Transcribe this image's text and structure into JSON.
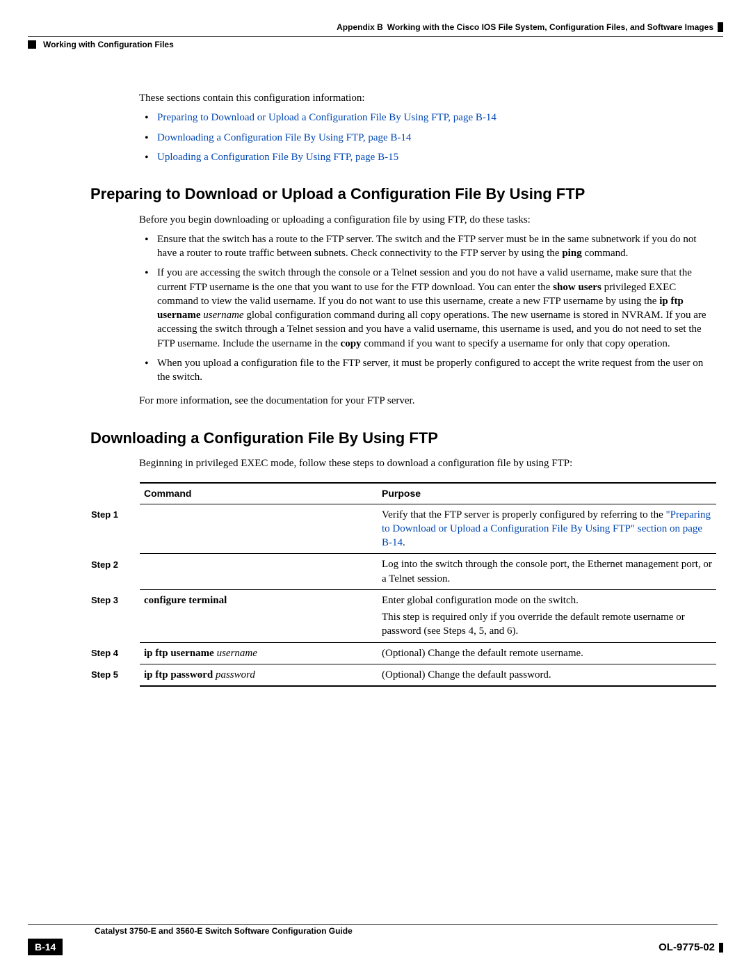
{
  "header": {
    "appendix": "Appendix B",
    "title": "Working with the Cisco IOS File System, Configuration Files, and Software Images",
    "section": "Working with Configuration Files"
  },
  "intro": "These sections contain this configuration information:",
  "toc": [
    "Preparing to Download or Upload a Configuration File By Using FTP, page B-14",
    "Downloading a Configuration File By Using FTP, page B-14",
    "Uploading a Configuration File By Using FTP, page B-15"
  ],
  "s1": {
    "heading": "Preparing to Download or Upload a Configuration File By Using FTP",
    "lead": "Before you begin downloading or uploading a configuration file by using FTP, do these tasks:",
    "b1": {
      "t1": "Ensure that the switch has a route to the FTP server. The switch and the FTP server must be in the same subnetwork if you do not have a router to route traffic between subnets. Check connectivity to the FTP server by using the ",
      "ping": "ping",
      "t2": " command."
    },
    "b2": {
      "t1": "If you are accessing the switch through the console or a Telnet session and you do not have a valid username, make sure that the current FTP username is the one that you want to use for the FTP download. You can enter the ",
      "showusers": "show users",
      "t2": " privileged EXEC command to view the valid username. If you do not want to use this username, create a new FTP username by using the ",
      "ipftpuser": "ip ftp username",
      "t3": " ",
      "usernameItalic": "username",
      "t4": " global configuration command during all copy operations. The new username is stored in NVRAM. If you are accessing the switch through a Telnet session and you have a valid username, this username is used, and you do not need to set the FTP username. Include the username in the ",
      "copy": "copy",
      "t5": " command if you want to specify a username for only that copy operation."
    },
    "b3": "When you upload a configuration file to the FTP server, it must be properly configured to accept the write request from the user on the switch.",
    "outro": "For more information, see the documentation for your FTP server."
  },
  "s2": {
    "heading": "Downloading a Configuration File By Using FTP",
    "lead": "Beginning in privileged EXEC mode, follow these steps to download a configuration file by using FTP:"
  },
  "table": {
    "h_command": "Command",
    "h_purpose": "Purpose",
    "r1": {
      "step": "Step 1",
      "cmd": "",
      "p_t1": "Verify that the FTP server is properly configured by referring to the ",
      "p_link": "\"Preparing to Download or Upload a Configuration File By Using FTP\" section on page B-14",
      "p_t2": "."
    },
    "r2": {
      "step": "Step 2",
      "cmd": "",
      "p": "Log into the switch through the console port, the Ethernet management port, or a Telnet session."
    },
    "r3": {
      "step": "Step 3",
      "cmd_bold": "configure terminal",
      "p1": "Enter global configuration mode on the switch.",
      "p2": "This step is required only if you override the default remote username or password (see Steps 4, 5, and 6)."
    },
    "r4": {
      "step": "Step 4",
      "cmd_bold": "ip ftp username",
      "cmd_italic": "username",
      "p": "(Optional) Change the default remote username."
    },
    "r5": {
      "step": "Step 5",
      "cmd_bold": "ip ftp password",
      "cmd_italic": "password",
      "p": "(Optional) Change the default password."
    }
  },
  "footer": {
    "guide": "Catalyst 3750-E and 3560-E Switch Software Configuration Guide",
    "page": "B-14",
    "docnum": "OL-9775-02"
  }
}
